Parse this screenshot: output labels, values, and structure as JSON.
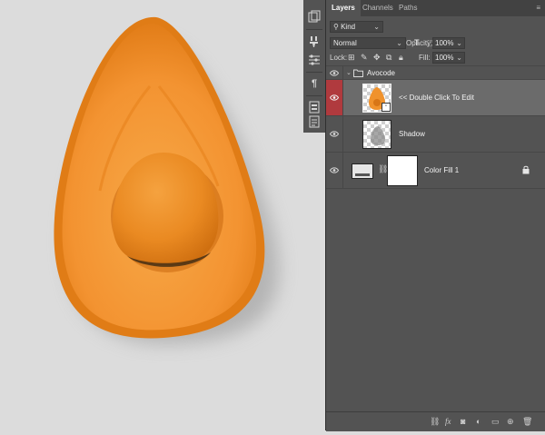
{
  "panel": {
    "tabs": [
      "Layers",
      "Channels",
      "Paths"
    ],
    "filter": "Kind",
    "blend_mode": "Normal",
    "opacity_label": "Opacity:",
    "opacity_value": "100%",
    "lock_label": "Lock:",
    "fill_label": "Fill:",
    "fill_value": "100%"
  },
  "layers": [
    {
      "name": "Avocode",
      "type": "group",
      "expanded": true
    },
    {
      "name": "<< Double Click To Edit",
      "type": "smart-object",
      "selected": true
    },
    {
      "name": "Shadow",
      "type": "pixel"
    },
    {
      "name": "Color Fill 1",
      "type": "fill",
      "locked": true
    }
  ],
  "colors": {
    "panel_bg": "#535353",
    "selected_row": "#6b6b6b",
    "visibility_highlight": "#b03a3e",
    "canvas_bg": "#dcdcdc",
    "avocado_orange": "#f2902a"
  },
  "icons": {
    "side_toolbar": [
      "history-icon",
      "brush-settings-icon",
      "adjustments-icon",
      "paragraph-icon",
      "libraries-icon",
      "properties-icon"
    ],
    "bottom_bar": [
      "link-layers-icon",
      "fx-icon",
      "layer-mask-icon",
      "adjustment-layer-icon",
      "new-group-icon",
      "new-layer-icon",
      "delete-icon"
    ]
  }
}
